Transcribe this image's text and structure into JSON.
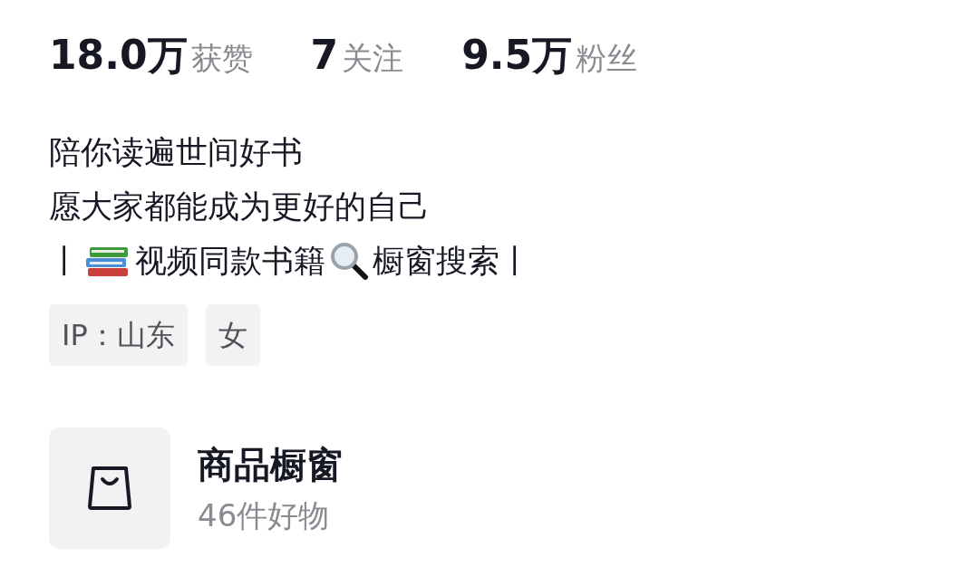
{
  "stats": [
    {
      "count": "18.0万",
      "caption": "获赞"
    },
    {
      "count": "7",
      "caption": "关注"
    },
    {
      "count": "9.5万",
      "caption": "粉丝"
    }
  ],
  "bio": {
    "lines": [
      "陪你读遍世间好书",
      "愿大家都能成为更好的自己"
    ],
    "links_line": {
      "before": "丨",
      "middle": "视频同款书籍",
      "after": "橱窗搜索丨"
    }
  },
  "tags": [
    "IP：山东",
    "女"
  ],
  "shop": {
    "title": "商品橱窗",
    "subtitle": "46件好物"
  }
}
